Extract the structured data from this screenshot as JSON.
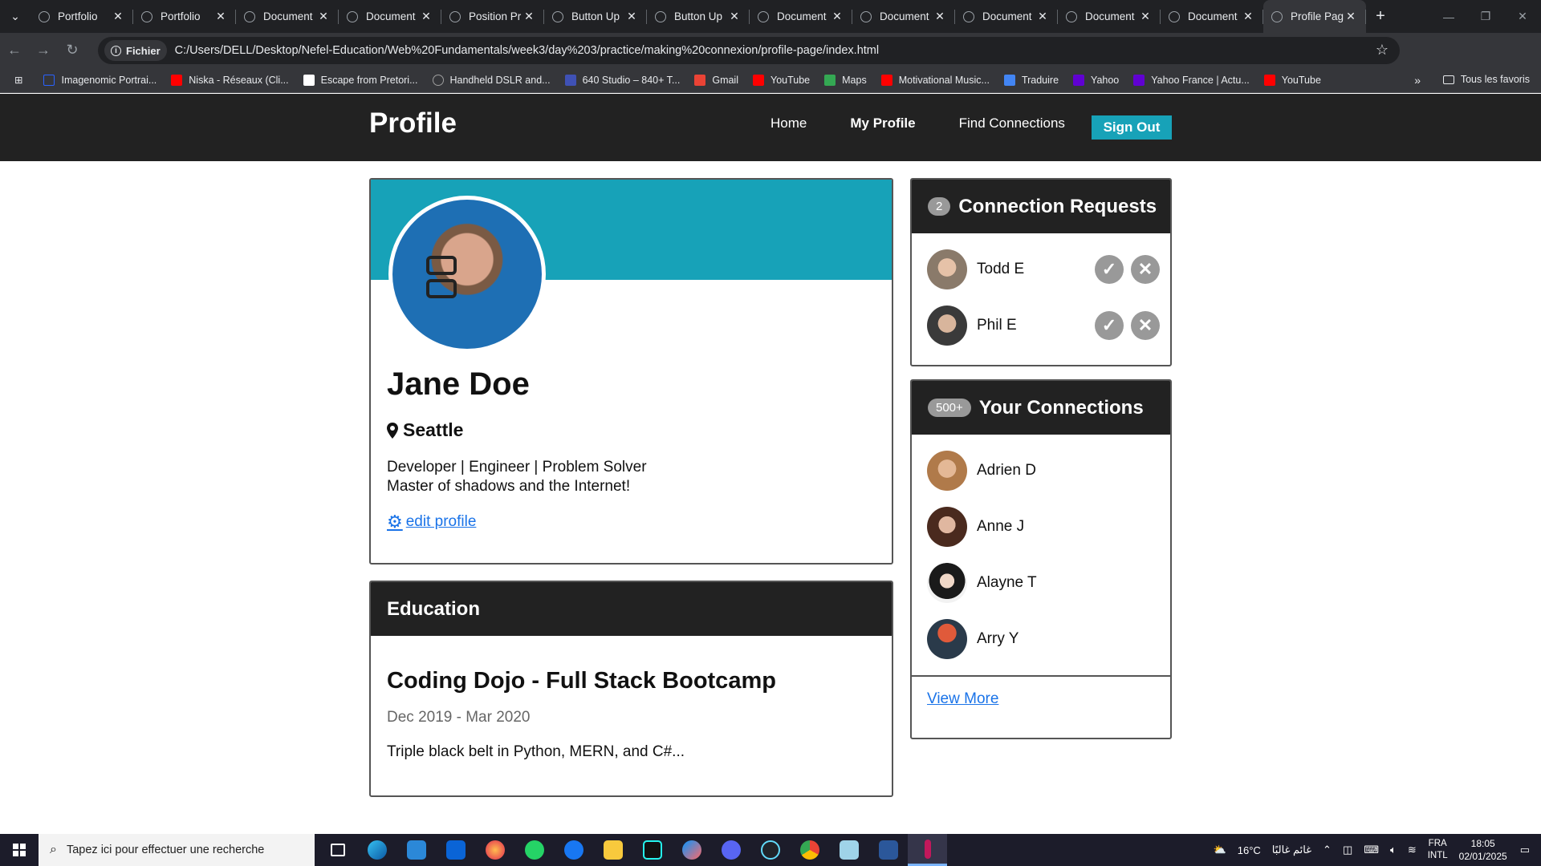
{
  "browser": {
    "tabs": [
      {
        "label": "Portfolio"
      },
      {
        "label": "Portfolio"
      },
      {
        "label": "Document"
      },
      {
        "label": "Document"
      },
      {
        "label": "Position Pr"
      },
      {
        "label": "Button Up"
      },
      {
        "label": "Button Up"
      },
      {
        "label": "Document"
      },
      {
        "label": "Document"
      },
      {
        "label": "Document"
      },
      {
        "label": "Document"
      },
      {
        "label": "Document"
      },
      {
        "label": "Profile Pag"
      }
    ],
    "address_chip": "Fichier",
    "url": "C:/Users/DELL/Desktop/Nefel-Education/Web%20Fundamentals/week3/day%203/practice/making%20connexion/profile-page/index.html",
    "bookmarks": [
      {
        "label": "Imagenomic Portrai...",
        "color": "#2962ff"
      },
      {
        "label": "Niska - Réseaux (Cli...",
        "color": "#ff0000"
      },
      {
        "label": "Escape from Pretori...",
        "color": "#ffffff"
      },
      {
        "label": "Handheld DSLR and...",
        "color": "#9e9e9e"
      },
      {
        "label": "640 Studio – 840+ T...",
        "color": "#3f51b5"
      },
      {
        "label": "Gmail",
        "color": "#ea4335"
      },
      {
        "label": "YouTube",
        "color": "#ff0000"
      },
      {
        "label": "Maps",
        "color": "#34a853"
      },
      {
        "label": "Motivational Music...",
        "color": "#ff0000"
      },
      {
        "label": "Traduire",
        "color": "#4285f4"
      },
      {
        "label": "Yahoo",
        "color": "#6001d2"
      },
      {
        "label": "Yahoo France | Actu...",
        "color": "#6001d2"
      },
      {
        "label": "YouTube",
        "color": "#ff0000"
      }
    ],
    "all_bookmarks": "Tous les favoris"
  },
  "site": {
    "brand": "Profile",
    "nav": {
      "home": "Home",
      "my_profile": "My Profile",
      "find": "Find Connections",
      "signout": "Sign Out"
    },
    "accent": "#17a2b8"
  },
  "profile": {
    "name": "Jane Doe",
    "location": "Seattle",
    "bio_line1": "Developer | Engineer | Problem Solver",
    "bio_line2": "Master of shadows and the Internet!",
    "edit": "edit profile"
  },
  "education": {
    "header": "Education",
    "title": "Coding Dojo - Full Stack Bootcamp",
    "dates": "Dec 2019 - Mar 2020",
    "description": "Triple black belt in Python, MERN, and C#..."
  },
  "requests": {
    "count": "2",
    "header": "Connection Requests",
    "items": [
      {
        "name": "Todd E"
      },
      {
        "name": "Phil E"
      }
    ]
  },
  "connections": {
    "count": "500+",
    "header": "Your Connections",
    "items": [
      {
        "name": "Adrien D"
      },
      {
        "name": "Anne J"
      },
      {
        "name": "Alayne T"
      },
      {
        "name": "Arry Y"
      }
    ],
    "view_more": "View More"
  },
  "taskbar": {
    "search_placeholder": "Tapez ici pour effectuer une recherche",
    "weather": "16°C",
    "weather_text": "غائم غالبًا",
    "lang1": "FRA",
    "lang2": "INTL",
    "time": "18:05",
    "date": "02/01/2025"
  }
}
